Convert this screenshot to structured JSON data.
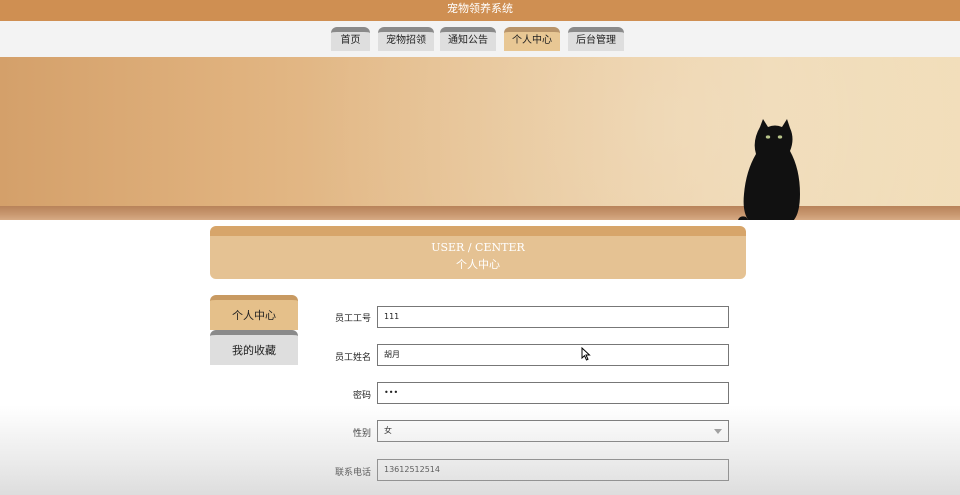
{
  "app": {
    "title": "宠物领养系统"
  },
  "nav": {
    "items": [
      {
        "label": "首页"
      },
      {
        "label": "宠物招领"
      },
      {
        "label": "通知公告"
      },
      {
        "label": "个人中心"
      },
      {
        "label": "后台管理"
      }
    ],
    "active": "个人中心"
  },
  "header": {
    "title_en": "USER / CENTER",
    "title_cn": "个人中心"
  },
  "sidebar": {
    "items": [
      {
        "label": "个人中心"
      },
      {
        "label": "我的收藏"
      }
    ],
    "active": "个人中心"
  },
  "form": {
    "employee_id": {
      "label": "员工工号",
      "value": "111"
    },
    "employee_name": {
      "label": "员工姓名",
      "value": "胡月"
    },
    "password": {
      "label": "密码",
      "value": "•••"
    },
    "gender": {
      "label": "性别",
      "value": "女"
    },
    "phone": {
      "label": "联系电话",
      "value": "13612512514"
    }
  },
  "colors": {
    "accent": "#cf8f52",
    "tab_active": "#e8c794",
    "tab_default": "#dedede"
  }
}
